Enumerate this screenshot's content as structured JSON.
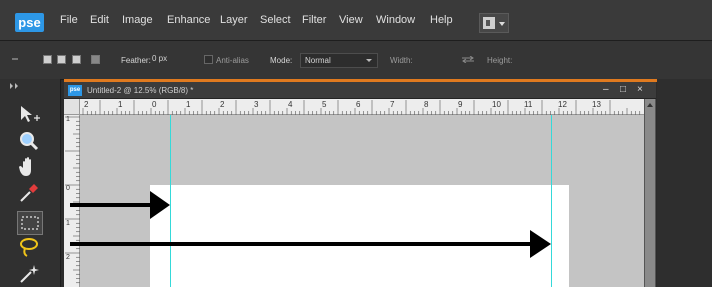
{
  "app": {
    "logo_text": "pse"
  },
  "menubar": {
    "items": [
      "File",
      "Edit",
      "Image",
      "Enhance",
      "Layer",
      "Select",
      "Filter",
      "View",
      "Window",
      "Help"
    ]
  },
  "options_bar": {
    "feather_label": "Feather:",
    "feather_value": "0 px",
    "antialias_label": "Anti-alias",
    "mode_label": "Mode:",
    "mode_value": "Normal",
    "width_label": "Width:",
    "height_label": "Height:"
  },
  "document": {
    "title": "Untitled-2 @ 12.5% (RGB/8) *",
    "doc_icon_text": "pse",
    "minimize": "–",
    "maximize": "□",
    "close": "×"
  },
  "ruler": {
    "top_numbers": [
      "2",
      "1",
      "0",
      "1",
      "2",
      "3",
      "4",
      "5",
      "6",
      "7",
      "8",
      "9",
      "10",
      "11",
      "12",
      "13"
    ],
    "left_numbers": [
      "1",
      "0",
      "1",
      "2"
    ]
  },
  "tools": [
    "move-tool",
    "zoom-tool",
    "hand-tool",
    "eyedropper-tool",
    "rectangular-marquee-tool",
    "lasso-tool",
    "magic-wand-tool"
  ],
  "colors": {
    "accent": "#2d97e6",
    "guide": "#34d9d9",
    "window_accent": "#e07a1f",
    "canvas": "#ffffff",
    "pasteboard": "#c4c4c4"
  }
}
